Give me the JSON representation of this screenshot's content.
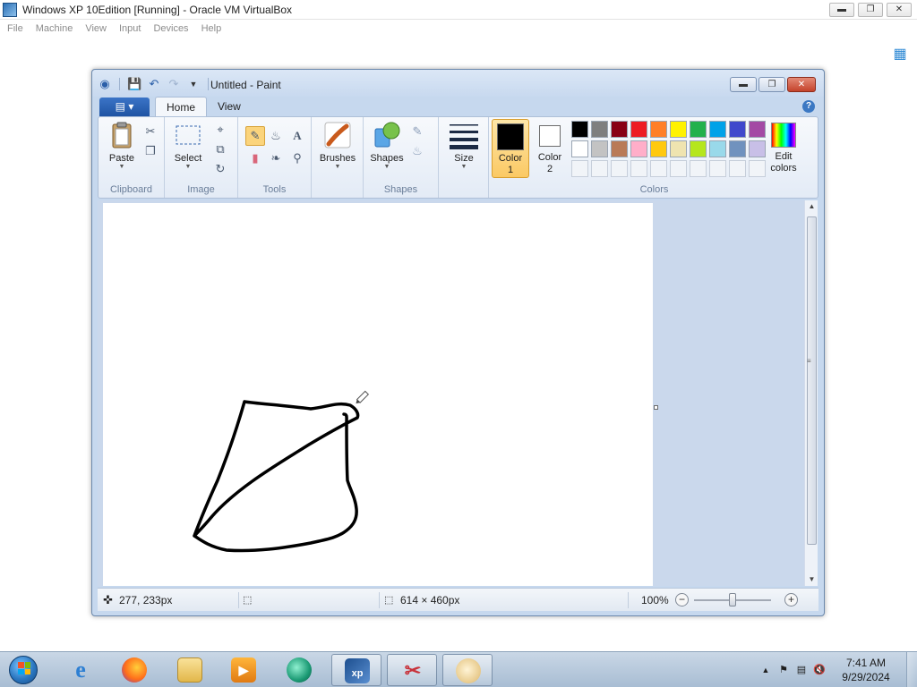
{
  "host": {
    "title": "Windows XP 10Edition [Running] - Oracle VM VirtualBox",
    "menu": [
      "File",
      "Machine",
      "View",
      "Input",
      "Devices",
      "Help"
    ]
  },
  "paint": {
    "title": "Untitled - Paint",
    "tabs": [
      "Home",
      "View"
    ],
    "groups": {
      "clipboard": {
        "label": "Clipboard",
        "paste": "Paste"
      },
      "image": {
        "label": "Image",
        "select": "Select"
      },
      "tools": {
        "label": "Tools"
      },
      "brushes": {
        "label": "Brushes"
      },
      "shapes": {
        "label": "Shapes",
        "button": "Shapes"
      },
      "size": {
        "label": "Size"
      },
      "colors": {
        "label": "Colors",
        "color1_line1": "Color",
        "color1_line2": "1",
        "color2_line1": "Color",
        "color2_line2": "2",
        "edit_line1": "Edit",
        "edit_line2": "colors",
        "color1_value": "#000000",
        "color2_value": "#ffffff",
        "palette_row1": [
          "#000000",
          "#7f7f7f",
          "#880015",
          "#ed1c24",
          "#ff7f27",
          "#fff200",
          "#22b14c",
          "#00a2e8",
          "#3f48cc",
          "#a349a4"
        ],
        "palette_row2": [
          "#ffffff",
          "#c3c3c3",
          "#b97a57",
          "#ffaec9",
          "#ffc90e",
          "#efe4b0",
          "#b5e61d",
          "#99d9ea",
          "#7092be",
          "#c8bfe7"
        ]
      }
    },
    "status": {
      "cursor_pos": "277, 233px",
      "selection_size": "",
      "canvas_size": "614 × 460px",
      "zoom": "100%"
    }
  },
  "taskbar": {
    "clock_time": "7:41 AM",
    "clock_date": "9/29/2024"
  },
  "colors": {
    "accent": "#1f54a3",
    "ribbon_bg": "#e3ebf6",
    "taskbar_bg": "#a8bdd3"
  }
}
